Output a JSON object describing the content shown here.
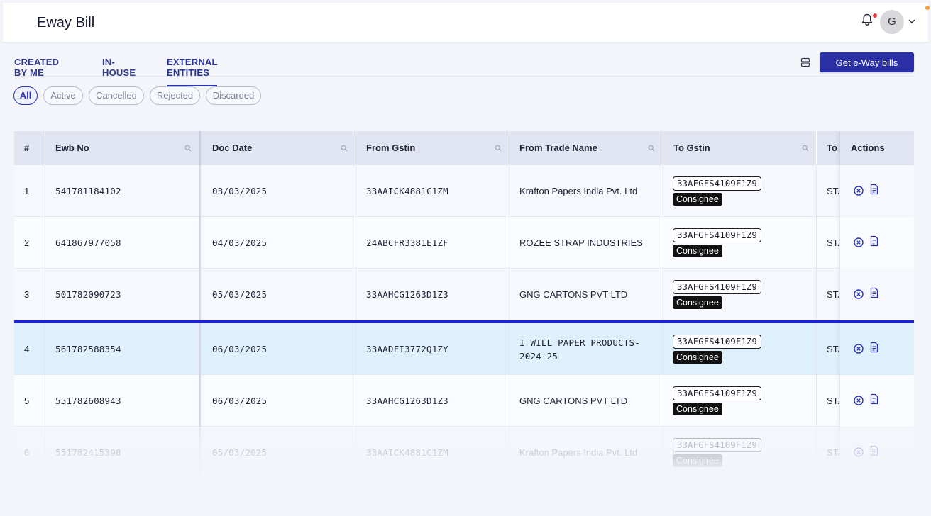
{
  "app": {
    "title": "Eway Bill"
  },
  "header": {
    "avatar_initial": "G"
  },
  "tabs": [
    {
      "label": "CREATED BY ME",
      "active": false
    },
    {
      "label": "IN-HOUSE",
      "active": false
    },
    {
      "label": "EXTERNAL ENTITIES",
      "active": true
    }
  ],
  "toolbar": {
    "get_button_label": "Get e-Way bills"
  },
  "filters": [
    {
      "label": "All",
      "active": true
    },
    {
      "label": "Active",
      "active": false
    },
    {
      "label": "Cancelled",
      "active": false
    },
    {
      "label": "Rejected",
      "active": false
    },
    {
      "label": "Discarded",
      "active": false
    }
  ],
  "table": {
    "columns": [
      "#",
      "Ewb No",
      "Doc Date",
      "From Gstin",
      "From Trade Name",
      "To Gstin",
      "To T",
      "Actions"
    ],
    "rows": [
      {
        "num": "1",
        "ewb_no": "541781184102",
        "doc_date": "03/03/2025",
        "from_gstin": "33AAICK4881C1ZM",
        "from_trade_name": "Krafton Papers India Pvt. Ltd",
        "to_gstin": "33AFGFS4109F1Z9",
        "to_role": "Consignee",
        "to_trade_name": "STA"
      },
      {
        "num": "2",
        "ewb_no": "641867977058",
        "doc_date": "04/03/2025",
        "from_gstin": "24ABCFR3381E1ZF",
        "from_trade_name": "ROZEE STRAP INDUSTRIES",
        "to_gstin": "33AFGFS4109F1Z9",
        "to_role": "Consignee",
        "to_trade_name": "STA"
      },
      {
        "num": "3",
        "ewb_no": "501782090723",
        "doc_date": "05/03/2025",
        "from_gstin": "33AAHCG1263D1Z3",
        "from_trade_name": "GNG CARTONS PVT LTD",
        "to_gstin": "33AFGFS4109F1Z9",
        "to_role": "Consignee",
        "to_trade_name": "STA"
      },
      {
        "num": "4",
        "ewb_no": "561782588354",
        "doc_date": "06/03/2025",
        "from_gstin": "33AADFI3772Q1ZY",
        "from_trade_name_line1": "I WILL PAPER PRODUCTS-",
        "from_trade_name_line2": "2024-25",
        "to_gstin": "33AFGFS4109F1Z9",
        "to_role": "Consignee",
        "to_trade_name": "STA"
      },
      {
        "num": "5",
        "ewb_no": "551782608943",
        "doc_date": "06/03/2025",
        "from_gstin": "33AAHCG1263D1Z3",
        "from_trade_name": "GNG CARTONS PVT LTD",
        "to_gstin": "33AFGFS4109F1Z9",
        "to_role": "Consignee",
        "to_trade_name": "STA"
      },
      {
        "num": "6",
        "ewb_no": "551782415398",
        "doc_date": "05/03/2025",
        "from_gstin": "33AAICK4881C1ZM",
        "from_trade_name": "Krafton Papers India Pvt. Ltd",
        "to_gstin": "33AFGFS4109F1Z9",
        "to_role": "Consignee",
        "to_trade_name": "STA"
      }
    ]
  },
  "colors": {
    "accent": "#2a2fa6",
    "selected_row_bg": "#def0fb",
    "selected_row_border": "#1b22d8"
  },
  "icons": {
    "notifications": "bell-icon",
    "layout": "layout-toggle-icon",
    "cancel": "cancel-circle-icon",
    "document": "document-icon"
  }
}
